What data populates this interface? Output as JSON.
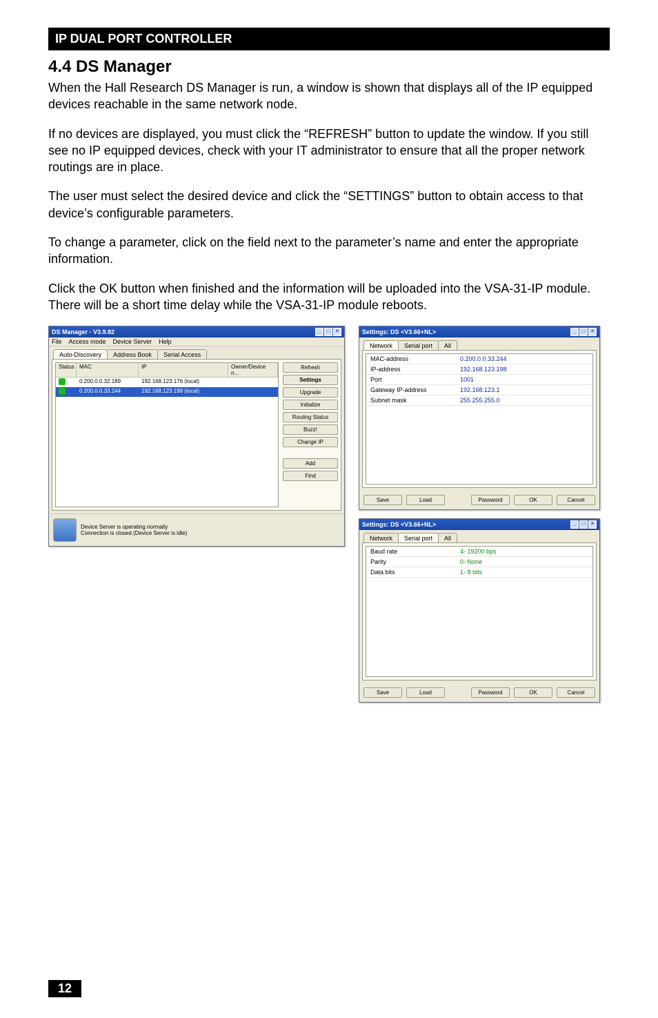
{
  "header": {
    "title": "IP DUAL PORT CONTROLLER"
  },
  "section": {
    "heading": "4.4 DS Manager",
    "p1": "When the Hall Research DS Manager is run, a window is shown that displays all of the IP equipped devices reachable in the same network node.",
    "p2": "If no devices are displayed, you must click the “REFRESH” button to update the window. If you still see no IP equipped devices, check with your IT administrator to ensure that all the proper network routings are in place.",
    "p3": "The user must select the desired device and click the “SETTINGS” button to obtain access to that device’s configurable parameters.",
    "p4": "To change a parameter, click on the field next to the parameter’s name and enter the appropriate information.",
    "p5": "Click the OK button when finished and the information will be uploaded into the VSA-31-IP module.  There will be a short time delay while the VSA-31-IP module reboots."
  },
  "dsmgr": {
    "title": "DS Manager - V3.9.82",
    "menu": {
      "file": "File",
      "access": "Access mode",
      "device": "Device Server",
      "help": "Help"
    },
    "tabs": {
      "auto": "Auto-Discovery",
      "address": "Address Book",
      "serial": "Serial Access"
    },
    "cols": {
      "status": "Status",
      "mac": "MAC",
      "ip": "IP",
      "owner": "Owner/Device n..."
    },
    "rows": [
      {
        "mac": "0.200.0.0.32.189",
        "ip": "192.168.123.176 (local)"
      },
      {
        "mac": "0.200.0.0.33.244",
        "ip": "192.168.123.198 (local)"
      }
    ],
    "buttons": {
      "refresh": "Refresh",
      "settings": "Settings",
      "upgrade": "Upgrade",
      "initialize": "Initialize",
      "routing": "Routing Status",
      "buzz": "Buzz!",
      "changeip": "Change IP",
      "add": "Add",
      "find": "Find"
    },
    "status1": "Device Server is operating normally",
    "status2": "Connection is closed (Device Server is idle)"
  },
  "settingsNet": {
    "title": "Settings: DS <V3.66+NL>",
    "tabs": {
      "network": "Network",
      "serial": "Serial port",
      "all": "All"
    },
    "rows": [
      {
        "k": "MAC-address",
        "v": "0.200.0.0.33.244"
      },
      {
        "k": "IP-address",
        "v": "192.168.123.198"
      },
      {
        "k": "Port",
        "v": "1001"
      },
      {
        "k": "Gateway IP-address",
        "v": "192.168.123.1"
      },
      {
        "k": "Subnet mask",
        "v": "255.255.255.0"
      }
    ],
    "buttons": {
      "save": "Save",
      "load": "Load",
      "password": "Password",
      "ok": "OK",
      "cancel": "Cancel"
    }
  },
  "settingsSerial": {
    "title": "Settings: DS <V3.66+NL>",
    "tabs": {
      "network": "Network",
      "serial": "Serial port",
      "all": "All"
    },
    "rows": [
      {
        "k": "Baud rate",
        "v": "4- 19200 bps"
      },
      {
        "k": "Parity",
        "v": "0- None"
      },
      {
        "k": "Data bits",
        "v": "1- 8 bits"
      }
    ],
    "buttons": {
      "save": "Save",
      "load": "Load",
      "password": "Password",
      "ok": "OK",
      "cancel": "Cancel"
    }
  },
  "pageNumber": "12",
  "winbtns": {
    "min": "_",
    "max": "□",
    "close": "×"
  }
}
